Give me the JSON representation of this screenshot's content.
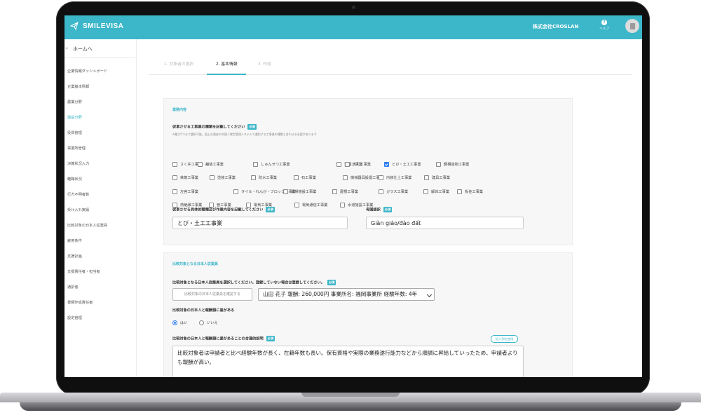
{
  "app": {
    "name": "SMILEVISA",
    "company": "株式会社CROSLAN",
    "help_label": "ヘルプ"
  },
  "sidebar": {
    "home_label": "ホームへ",
    "items": [
      {
        "label": "企業情報ダッシュボード",
        "active": false
      },
      {
        "label": "企業基本情報",
        "active": false
      },
      {
        "label": "農業分野",
        "active": false
      },
      {
        "label": "建設分野",
        "active": true
      },
      {
        "label": "役員管理",
        "active": false
      },
      {
        "label": "事業所管理",
        "active": false
      },
      {
        "label": "決算状況入力",
        "active": false
      },
      {
        "label": "離職状況",
        "active": false
      },
      {
        "label": "行方不明者数",
        "active": false
      },
      {
        "label": "受け入れ実績",
        "active": false
      },
      {
        "label": "比較対象の日本人従業員",
        "active": false
      },
      {
        "label": "雇用条件",
        "active": false
      },
      {
        "label": "支援計画",
        "active": false
      },
      {
        "label": "支援責任者・担当者",
        "active": false
      },
      {
        "label": "通訳者",
        "active": false
      },
      {
        "label": "書類作成責任者",
        "active": false
      },
      {
        "label": "設定管理",
        "active": false
      }
    ]
  },
  "tabs": [
    {
      "label": "1. 対象者の選択",
      "active": false
    },
    {
      "label": "2. 基本情報",
      "active": true
    },
    {
      "label": "3. 作成",
      "active": false
    }
  ],
  "work": {
    "section_title": "業務内容",
    "types_label": "従事させる工事業の種類を記載してください",
    "required": "必須",
    "note": "※最大5つまで選択可能。国土交通省の外国人就労管理システムで選択する工事業の種類と合わせる必要があります",
    "options": [
      {
        "label": "さく井工事業",
        "checked": false
      },
      {
        "label": "舗装工事業",
        "checked": false
      },
      {
        "label": "しゅんせつ工事業",
        "checked": false
      },
      {
        "label": "造園工事業",
        "checked": false
      },
      {
        "label": "大工工事業",
        "checked": false
      },
      {
        "label": "とび・土工工事業",
        "checked": true
      },
      {
        "label": "鋼構造物工事業",
        "checked": false
      },
      {
        "label": "鉄筋工事業",
        "checked": false
      },
      {
        "label": "塗装工事業",
        "checked": false
      },
      {
        "label": "防水工事業",
        "checked": false
      },
      {
        "label": "石工事業",
        "checked": false
      },
      {
        "label": "機械器具設置工事業",
        "checked": false
      },
      {
        "label": "内装仕上工事業",
        "checked": false
      },
      {
        "label": "建具工事業",
        "checked": false
      },
      {
        "label": "左官工事業",
        "checked": false
      },
      {
        "label": "タイル・れんが・ブロック工事業",
        "checked": false
      },
      {
        "label": "清掃施設工事業",
        "checked": false
      },
      {
        "label": "屋根工事業",
        "checked": false
      },
      {
        "label": "ガラス工事業",
        "checked": false
      },
      {
        "label": "解体工事業",
        "checked": false
      },
      {
        "label": "板金工事業",
        "checked": false
      },
      {
        "label": "熱絶縁工事業",
        "checked": false
      },
      {
        "label": "管工事業",
        "checked": false
      },
      {
        "label": "電気工事業",
        "checked": false
      },
      {
        "label": "電気通信工事業",
        "checked": false
      },
      {
        "label": "水道施設工事業",
        "checked": false
      },
      {
        "label": "消防施設工事業",
        "checked": false
      }
    ],
    "job_label": "従事させる具体的職種及び作業内容を記載してください",
    "job_value": "とび・土工工事業",
    "native_label": "母国語訳",
    "native_value": "Giàn giáo/đào đất"
  },
  "compare": {
    "section_title": "比較対象となる日本人従業員",
    "select_label": "比較対象となる日本人従業員を選択してください。登録していない場合は登録してください。",
    "search_button": "比較対象の日本人従業員を確認する",
    "selected_employee": "山田 花子 報酬: 260,000円 事業所名: 福岡事業所 経験年数: 4年",
    "diff_label": "比較対象の日本人と報酬額に差がある",
    "yes": "はい",
    "no": "いいえ",
    "reason_label": "比較対象の日本人と報酬額に差があることの合理的説明",
    "example_button": "記入例を使用",
    "reason_text": "比較対象者は申請者と比べ経験年数が長く、在籍年数も長い。保有資格や実際の業務遂行能力などから順調に昇給していったため、申請者よりも報酬が高い。"
  }
}
